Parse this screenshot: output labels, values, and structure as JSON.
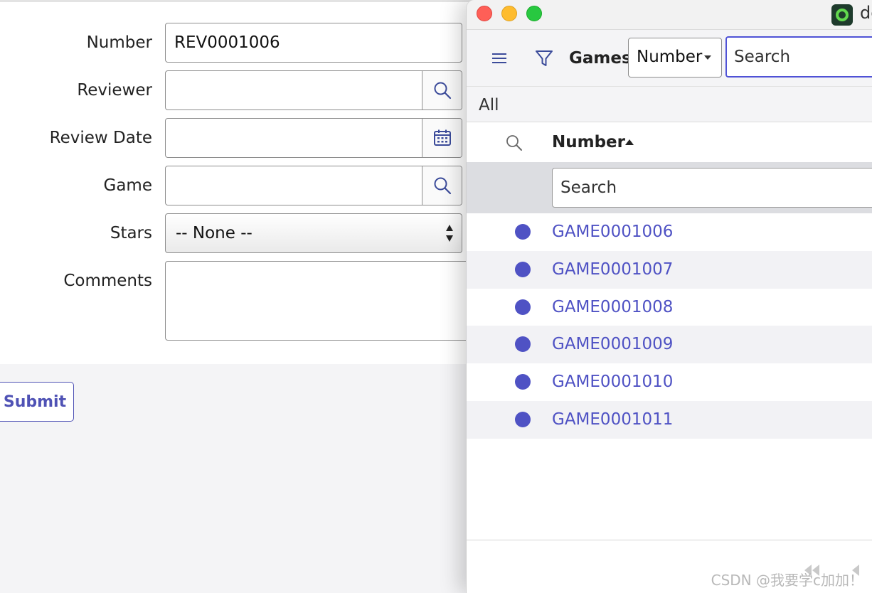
{
  "form": {
    "fields": {
      "number": {
        "label": "Number",
        "value": "REV0001006"
      },
      "reviewer": {
        "label": "Reviewer",
        "value": ""
      },
      "review_date": {
        "label": "Review Date",
        "value": ""
      },
      "game": {
        "label": "Game",
        "value": ""
      },
      "stars": {
        "label": "Stars",
        "value": "-- None --"
      },
      "comments": {
        "label": "Comments",
        "value": ""
      }
    },
    "submit_label": "Submit"
  },
  "popup": {
    "window_title": "de",
    "toolbar": {
      "title": "Games",
      "field_select": "Number",
      "search_placeholder": "Search"
    },
    "breadcrumb": "All",
    "column": {
      "title": "Number",
      "filter_placeholder": "Search"
    },
    "rows": [
      {
        "number": "GAME0001006"
      },
      {
        "number": "GAME0001007"
      },
      {
        "number": "GAME0001008"
      },
      {
        "number": "GAME0001009"
      },
      {
        "number": "GAME0001010"
      },
      {
        "number": "GAME0001011"
      }
    ]
  },
  "watermark": "CSDN @我要学c加加！",
  "colors": {
    "accent": "#4f52c4",
    "focus_border": "#4f52d6",
    "traffic_red": "#fe5f57",
    "traffic_yellow": "#febc2e",
    "traffic_green": "#28c840"
  }
}
